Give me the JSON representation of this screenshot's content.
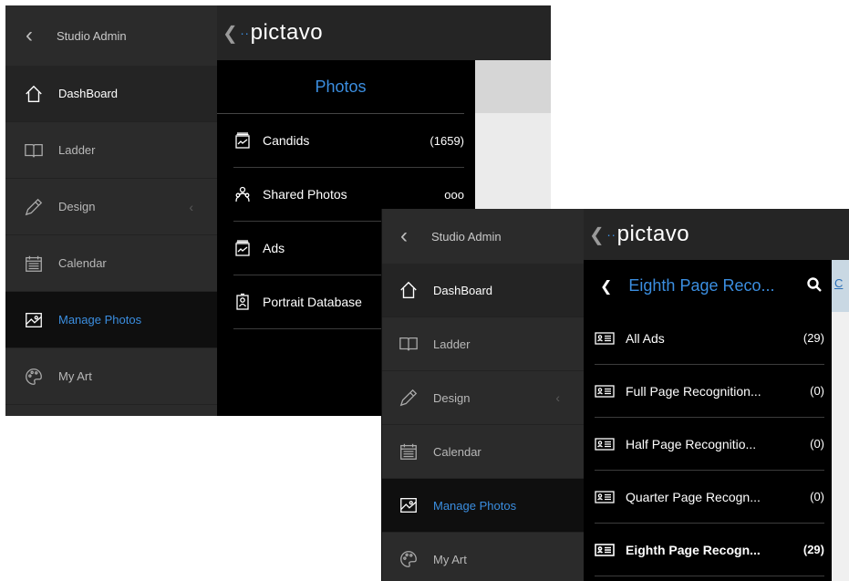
{
  "screen1": {
    "sidebar": {
      "header": "Studio Admin",
      "items": [
        {
          "label": "DashBoard",
          "icon": "home-icon"
        },
        {
          "label": "Ladder",
          "icon": "book-icon"
        },
        {
          "label": "Design",
          "icon": "pencil-icon"
        },
        {
          "label": "Calendar",
          "icon": "calendar-icon"
        },
        {
          "label": "Manage Photos",
          "icon": "photo-icon"
        },
        {
          "label": "My Art",
          "icon": "palette-icon"
        }
      ]
    },
    "logo": "pictavo",
    "panel": {
      "title": "Photos",
      "rows": [
        {
          "label": "Candids",
          "count": "(1659)",
          "icon": "album-icon"
        },
        {
          "label": "Shared Photos",
          "count": "ooo",
          "icon": "shared-users-icon"
        },
        {
          "label": "Ads",
          "count": "",
          "icon": "album-icon"
        },
        {
          "label": "Portrait Database",
          "count": "",
          "icon": "portrait-icon"
        }
      ]
    }
  },
  "screen2": {
    "sidebar": {
      "header": "Studio Admin",
      "items": [
        {
          "label": "DashBoard",
          "icon": "home-icon"
        },
        {
          "label": "Ladder",
          "icon": "book-icon"
        },
        {
          "label": "Design",
          "icon": "pencil-icon"
        },
        {
          "label": "Calendar",
          "icon": "calendar-icon"
        },
        {
          "label": "Manage Photos",
          "icon": "photo-icon"
        },
        {
          "label": "My Art",
          "icon": "palette-icon"
        }
      ]
    },
    "logo": "pictavo",
    "panel": {
      "title": "Eighth Page Reco...",
      "edge_link": "C",
      "rows": [
        {
          "label": "All Ads",
          "count": "(29)"
        },
        {
          "label": "Full Page Recognition...",
          "count": "(0)"
        },
        {
          "label": "Half Page Recognitio...",
          "count": "(0)"
        },
        {
          "label": "Quarter Page Recogn...",
          "count": "(0)"
        },
        {
          "label": "Eighth Page Recogn...",
          "count": "(29)"
        }
      ]
    }
  },
  "colors": {
    "accent": "#3b8ee0",
    "sidebar": "#2b2b2b",
    "panel": "#000000"
  }
}
